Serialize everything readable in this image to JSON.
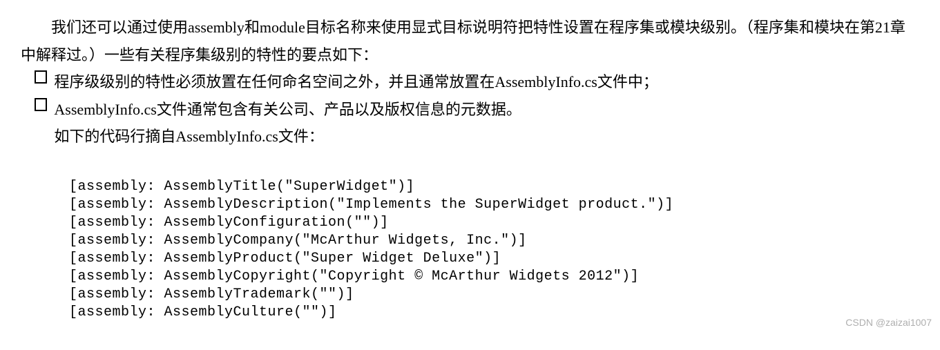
{
  "intro": {
    "p1": "我们还可以通过使用assembly和module目标名称来使用显式目标说明符把特性设置在程序集或模块级别。（程序集和模块在第21章中解释过。）一些有关程序集级别的特性的要点如下：",
    "bullets": [
      "程序级级别的特性必须放置在任何命名空间之外，并且通常放置在AssemblyInfo.cs文件中；",
      "AssemblyInfo.cs文件通常包含有关公司、产品以及版权信息的元数据。"
    ],
    "p2": "如下的代码行摘自AssemblyInfo.cs文件："
  },
  "code_lines": [
    "[assembly: AssemblyTitle(\"SuperWidget\")]",
    "[assembly: AssemblyDescription(\"Implements the SuperWidget product.\")]",
    "[assembly: AssemblyConfiguration(\"\")]",
    "[assembly: AssemblyCompany(\"McArthur Widgets, Inc.\")]",
    "[assembly: AssemblyProduct(\"Super Widget Deluxe\")]",
    "[assembly: AssemblyCopyright(\"Copyright © McArthur Widgets 2012\")]",
    "[assembly: AssemblyTrademark(\"\")]",
    "[assembly: AssemblyCulture(\"\")]"
  ],
  "watermark": "CSDN @zaizai1007"
}
